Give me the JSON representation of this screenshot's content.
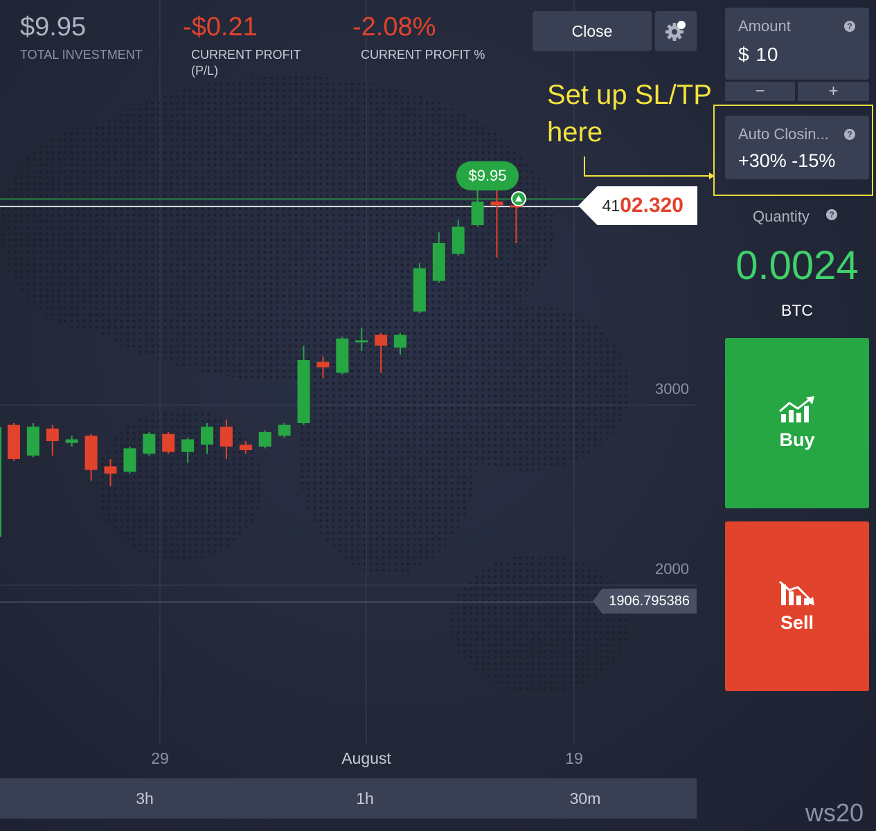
{
  "header": {
    "total_investment": {
      "value": "$9.95",
      "label": "TOTAL INVESTMENT"
    },
    "current_profit": {
      "value": "-$0.21",
      "label": "CURRENT PROFIT (P/L)"
    },
    "current_profit_pct": {
      "value": "-2.08%",
      "label": "CURRENT PROFIT %"
    },
    "close_label": "Close"
  },
  "sidebar": {
    "amount": {
      "label": "Amount",
      "value": "$ 10",
      "minus": "−",
      "plus": "+"
    },
    "auto_closing": {
      "label": "Auto Closin...",
      "value": "+30% -15%"
    },
    "quantity": {
      "label": "Quantity",
      "value": "0.0024",
      "unit": "BTC"
    },
    "buy_label": "Buy",
    "sell_label": "Sell"
  },
  "annotation": {
    "text_line1": "Set up SL/TP",
    "text_line2": "here"
  },
  "chart": {
    "current_price_prefix": "41",
    "current_price_suffix": "02.320",
    "low_price": "1906.795386",
    "profit_bubble": "$9.95",
    "y_labels": [
      "3000",
      "2000"
    ],
    "x_labels": [
      "29",
      "August",
      "19"
    ]
  },
  "timeframes": [
    "3h",
    "1h",
    "30m"
  ],
  "watermark": "ws20",
  "colors": {
    "up": "#27a744",
    "down": "#e2432c",
    "accent_yellow": "#f3e33c",
    "panel": "#3a4053"
  },
  "chart_data": {
    "type": "candlestick",
    "y_ticks": [
      3000,
      2000
    ],
    "current_price": 4102.32,
    "low_marker": 1906.795386,
    "candles": [
      {
        "o": 2890,
        "c": 2700,
        "h": 2900,
        "l": 2690
      },
      {
        "o": 2720,
        "c": 2880,
        "h": 2900,
        "l": 2710
      },
      {
        "o": 2870,
        "c": 2800,
        "h": 2890,
        "l": 2720
      },
      {
        "o": 2790,
        "c": 2810,
        "h": 2830,
        "l": 2770
      },
      {
        "o": 2830,
        "c": 2640,
        "h": 2840,
        "l": 2580
      },
      {
        "o": 2660,
        "c": 2620,
        "h": 2700,
        "l": 2550
      },
      {
        "o": 2630,
        "c": 2760,
        "h": 2770,
        "l": 2620
      },
      {
        "o": 2730,
        "c": 2840,
        "h": 2850,
        "l": 2720
      },
      {
        "o": 2840,
        "c": 2740,
        "h": 2850,
        "l": 2730
      },
      {
        "o": 2740,
        "c": 2810,
        "h": 2820,
        "l": 2680
      },
      {
        "o": 2780,
        "c": 2880,
        "h": 2900,
        "l": 2730
      },
      {
        "o": 2880,
        "c": 2770,
        "h": 2920,
        "l": 2700
      },
      {
        "o": 2780,
        "c": 2750,
        "h": 2800,
        "l": 2730
      },
      {
        "o": 2770,
        "c": 2850,
        "h": 2860,
        "l": 2760
      },
      {
        "o": 2830,
        "c": 2890,
        "h": 2900,
        "l": 2820
      },
      {
        "o": 2900,
        "c": 3250,
        "h": 3330,
        "l": 2890
      },
      {
        "o": 3240,
        "c": 3210,
        "h": 3270,
        "l": 3150
      },
      {
        "o": 3180,
        "c": 3370,
        "h": 3380,
        "l": 3170
      },
      {
        "o": 3350,
        "c": 3360,
        "h": 3430,
        "l": 3300
      },
      {
        "o": 3390,
        "c": 3330,
        "h": 3400,
        "l": 3180
      },
      {
        "o": 3320,
        "c": 3390,
        "h": 3400,
        "l": 3280
      },
      {
        "o": 3520,
        "c": 3760,
        "h": 3790,
        "l": 3510
      },
      {
        "o": 3690,
        "c": 3900,
        "h": 3960,
        "l": 3680
      },
      {
        "o": 3840,
        "c": 3990,
        "h": 4030,
        "l": 3830
      },
      {
        "o": 4000,
        "c": 4130,
        "h": 4200,
        "l": 3990
      },
      {
        "o": 4130,
        "c": 4110,
        "h": 4300,
        "l": 3820
      },
      {
        "o": 4110,
        "c": 4100,
        "h": 4120,
        "l": 3900
      }
    ]
  }
}
